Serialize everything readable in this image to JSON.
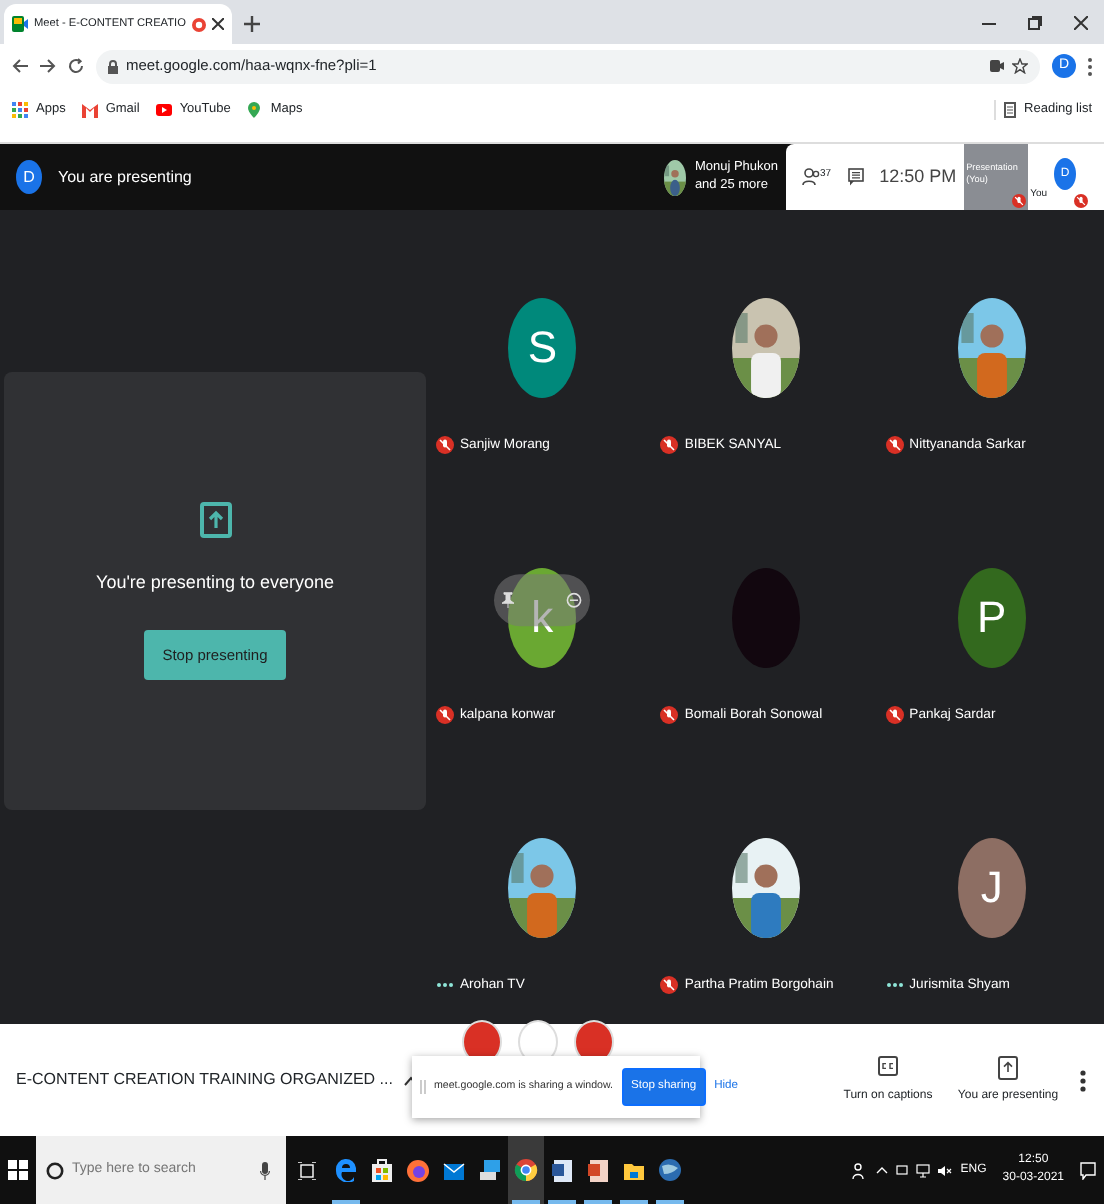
{
  "browser": {
    "tab": {
      "title": "Meet - E-CONTENT CREATIO",
      "recording": true
    },
    "address": "meet.google.com/haa-wqnx-fne?pli=1",
    "profile": "D",
    "bookmarks": [
      {
        "label": "Apps",
        "kind": "apps"
      },
      {
        "label": "Gmail",
        "kind": "gmail"
      },
      {
        "label": "YouTube",
        "kind": "youtube"
      },
      {
        "label": "Maps",
        "kind": "maps"
      }
    ],
    "reading_list": "Reading list"
  },
  "meet_header": {
    "avatar": "D",
    "status": "You are presenting",
    "featured": {
      "name": "Monuj Phukon",
      "more": "and 25 more"
    },
    "people_count": "37",
    "time": "12:50 PM",
    "self_tiles": [
      {
        "label": "Presentation (You)",
        "kind": "presentation",
        "muted": true
      },
      {
        "label": "You",
        "kind": "camera",
        "avatar": "D",
        "muted": true
      }
    ]
  },
  "presentation": {
    "message": "You're presenting to everyone",
    "button": "Stop presenting"
  },
  "participants": [
    {
      "name": "Sanjiw Morang",
      "kind": "letter",
      "letter": "S",
      "color": "#00897b",
      "muted": true,
      "hovered": false
    },
    {
      "name": "BIBEK SANYAL",
      "kind": "picture",
      "muted": true,
      "hovered": false
    },
    {
      "name": "Nittyananda Sarkar",
      "kind": "picture",
      "muted": true,
      "hovered": false
    },
    {
      "name": "kalpana konwar",
      "kind": "letter",
      "letter": "k",
      "color": "#6aa832",
      "muted": true,
      "hovered": true
    },
    {
      "name": "Bomali Borah Sonowal",
      "kind": "blank",
      "color": "#12070f",
      "muted": true,
      "hovered": false
    },
    {
      "name": "Pankaj Sardar",
      "kind": "letter",
      "letter": "P",
      "color": "#33691e",
      "muted": true,
      "hovered": false
    },
    {
      "name": "Arohan TV",
      "kind": "picture",
      "muted": false,
      "hovered": false
    },
    {
      "name": "Partha Pratim Borgohain",
      "kind": "picture",
      "muted": true,
      "hovered": false
    },
    {
      "name": "Jurismita Shyam",
      "kind": "letter",
      "letter": "J",
      "color": "#8d6e63",
      "muted": false,
      "hovered": false
    }
  ],
  "controls": {
    "meeting_title": "E-CONTENT CREATION TRAINING ORGANIZED ...",
    "call_buttons": [
      {
        "kind": "mic"
      },
      {
        "kind": "camera"
      },
      {
        "kind": "hangup"
      }
    ],
    "actions": [
      {
        "label": "Turn on captions",
        "kind": "captions"
      },
      {
        "label": "You are presenting",
        "kind": "present"
      }
    ]
  },
  "share_banner": {
    "message": "meet.google.com is sharing a window.",
    "stop": "Stop sharing",
    "hide": "Hide"
  },
  "taskbar": {
    "search_placeholder": "Type here to search",
    "apps": [
      {
        "kind": "edge",
        "running": true,
        "selected": false
      },
      {
        "kind": "store",
        "running": false,
        "selected": false
      },
      {
        "kind": "firefox",
        "running": false,
        "selected": false
      },
      {
        "kind": "mail",
        "running": false,
        "selected": false
      },
      {
        "kind": "pc",
        "running": false,
        "selected": false
      },
      {
        "kind": "chrome",
        "running": true,
        "selected": true
      },
      {
        "kind": "word",
        "running": true,
        "selected": false
      },
      {
        "kind": "powerpoint",
        "running": true,
        "selected": false
      },
      {
        "kind": "explorer",
        "running": true,
        "selected": false
      },
      {
        "kind": "globe",
        "running": true,
        "selected": false
      }
    ],
    "language": "ENG",
    "time": "12:50",
    "date": "30-03-2021"
  }
}
